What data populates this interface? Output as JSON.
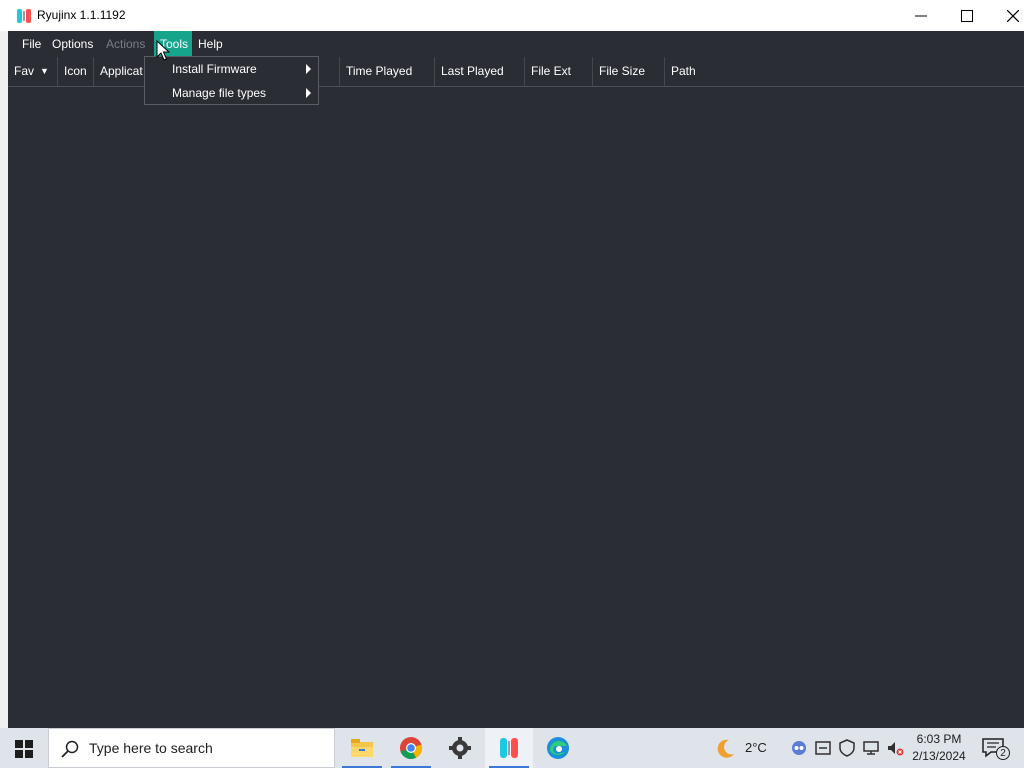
{
  "window": {
    "title": "Ryujinx 1.1.1192",
    "controls": [
      "minimize-icon",
      "maximize-icon",
      "close-icon"
    ]
  },
  "menubar": {
    "items": [
      {
        "label": "File",
        "state": "normal"
      },
      {
        "label": "Options",
        "state": "normal"
      },
      {
        "label": "Actions",
        "state": "disabled"
      },
      {
        "label": "Tools",
        "state": "active"
      },
      {
        "label": "Help",
        "state": "normal"
      }
    ]
  },
  "columns": {
    "fav": "Fav",
    "icon": "Icon",
    "application": "Applicat",
    "time_played": "Time Played",
    "last_played": "Last Played",
    "file_ext": "File Ext",
    "file_size": "File Size",
    "path": "Path"
  },
  "tools_menu": {
    "items": [
      {
        "label": "Install Firmware",
        "has_submenu": true
      },
      {
        "label": "Manage file types",
        "has_submenu": true
      }
    ]
  },
  "taskbar": {
    "search_placeholder": "Type here to search",
    "apps": [
      "file-explorer-icon",
      "chrome-icon",
      "settings-icon",
      "ryujinx-icon",
      "edge-icon"
    ],
    "active_app": "ryujinx-icon",
    "weather": "2°C",
    "time": "6:03 PM",
    "date": "2/13/2024",
    "notification_count": "2"
  },
  "colors": {
    "window_bg": "#2a2d34",
    "menu_highlight": "#14a58c",
    "disabled_text": "#7a7d84",
    "taskbar_bg": "#dfe3ea"
  }
}
